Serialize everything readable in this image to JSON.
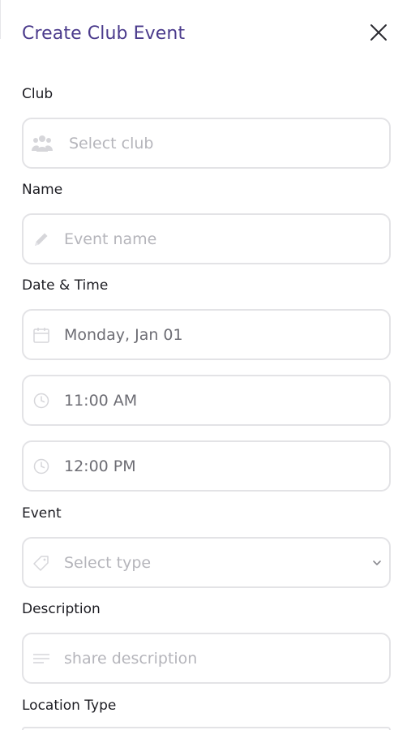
{
  "dialog": {
    "title": "Create Club Event"
  },
  "form": {
    "club": {
      "label": "Club",
      "placeholder": "Select club",
      "icon": "users-icon"
    },
    "name": {
      "label": "Name",
      "placeholder": "Event name",
      "icon": "pencil-icon"
    },
    "datetime": {
      "label": "Date & Time",
      "date": {
        "value": "Monday, Jan 01",
        "icon": "calendar-icon"
      },
      "start_time": {
        "value": "11:00 AM",
        "icon": "clock-icon"
      },
      "end_time": {
        "value": "12:00 PM",
        "icon": "clock-icon"
      }
    },
    "event": {
      "label": "Event",
      "placeholder": "Select type",
      "icon": "tag-icon"
    },
    "description": {
      "label": "Description",
      "placeholder": "share description",
      "icon": "lines-icon"
    },
    "location_type": {
      "label": "Location Type"
    }
  },
  "colors": {
    "accent": "#4b3b8c",
    "border": "#e3e3e6",
    "placeholder": "#b5b5bb",
    "value": "#6d6d74",
    "icon": "#d6d6da"
  }
}
